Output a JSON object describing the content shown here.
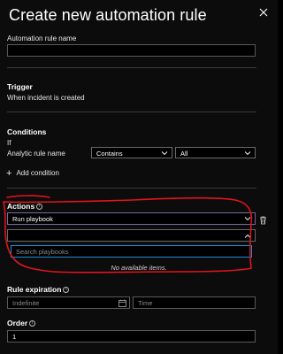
{
  "header": {
    "title": "Create new automation rule"
  },
  "name_field": {
    "label": "Automation rule name",
    "placeholder": ""
  },
  "trigger": {
    "heading": "Trigger",
    "value": "When incident is created"
  },
  "conditions": {
    "heading": "Conditions",
    "if_label": "If",
    "field": "Analytic rule name",
    "operator": "Contains",
    "value": "All",
    "add_label": "Add condition"
  },
  "actions": {
    "heading": "Actions",
    "action_value": "Run playbook",
    "search_placeholder": "Search playbooks",
    "empty_message": "No available items."
  },
  "expiration": {
    "heading": "Rule expiration",
    "date_placeholder": "Indefinite",
    "time_placeholder": "Time"
  },
  "order": {
    "heading": "Order",
    "value": "1"
  },
  "colors": {
    "accent": "#1f8ad7",
    "annotation": "#e0141e"
  }
}
